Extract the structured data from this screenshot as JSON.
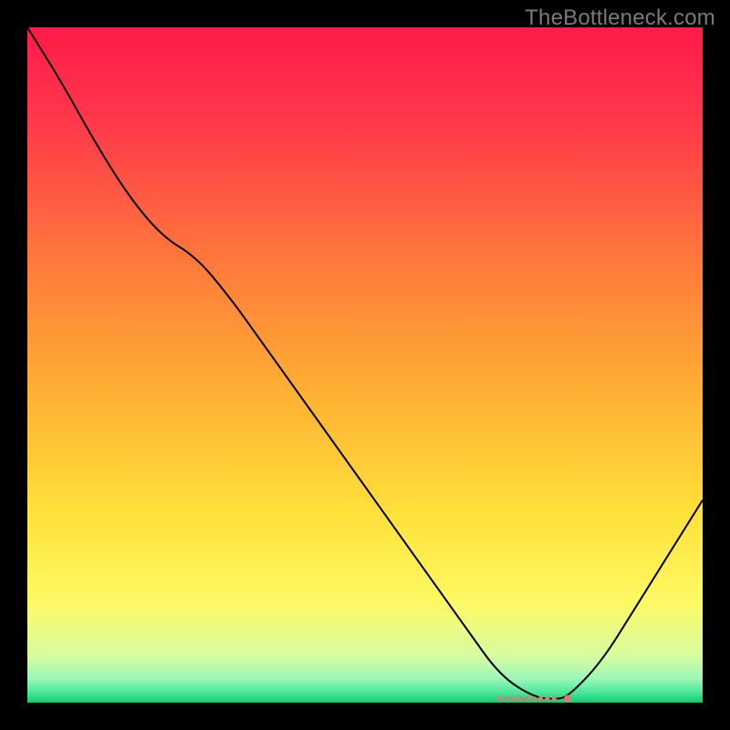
{
  "watermark": "TheBottleneck.com",
  "chart_data": {
    "type": "line",
    "title": "",
    "xlabel": "",
    "ylabel": "",
    "xlim": [
      0,
      100
    ],
    "ylim": [
      0,
      100
    ],
    "curve": {
      "x": [
        0,
        5,
        10,
        15,
        20,
        25,
        30,
        35,
        40,
        45,
        50,
        55,
        60,
        65,
        70,
        75,
        78,
        80,
        85,
        90,
        95,
        100
      ],
      "y": [
        100,
        92,
        83,
        75,
        69,
        66,
        60,
        53,
        46,
        39,
        32,
        25,
        18,
        11,
        4,
        0.8,
        0.5,
        0.8,
        6,
        14,
        22,
        30
      ]
    },
    "optimal_markers": {
      "x": [
        70,
        71,
        72,
        73,
        74,
        75,
        76,
        77,
        78,
        80
      ],
      "y": [
        0.6,
        0.6,
        0.6,
        0.6,
        0.6,
        0.6,
        0.6,
        0.6,
        0.6,
        0.6
      ]
    },
    "gradient_stops": [
      {
        "offset": 0.0,
        "color": "#ff1a4a"
      },
      {
        "offset": 0.15,
        "color": "#ff3b4a"
      },
      {
        "offset": 0.35,
        "color": "#ff7a3a"
      },
      {
        "offset": 0.55,
        "color": "#ffb233"
      },
      {
        "offset": 0.72,
        "color": "#ffe13a"
      },
      {
        "offset": 0.85,
        "color": "#fdf963"
      },
      {
        "offset": 0.93,
        "color": "#d8fca0"
      },
      {
        "offset": 0.965,
        "color": "#9af7b8"
      },
      {
        "offset": 0.985,
        "color": "#4be59a"
      },
      {
        "offset": 1.0,
        "color": "#16c96f"
      }
    ]
  }
}
